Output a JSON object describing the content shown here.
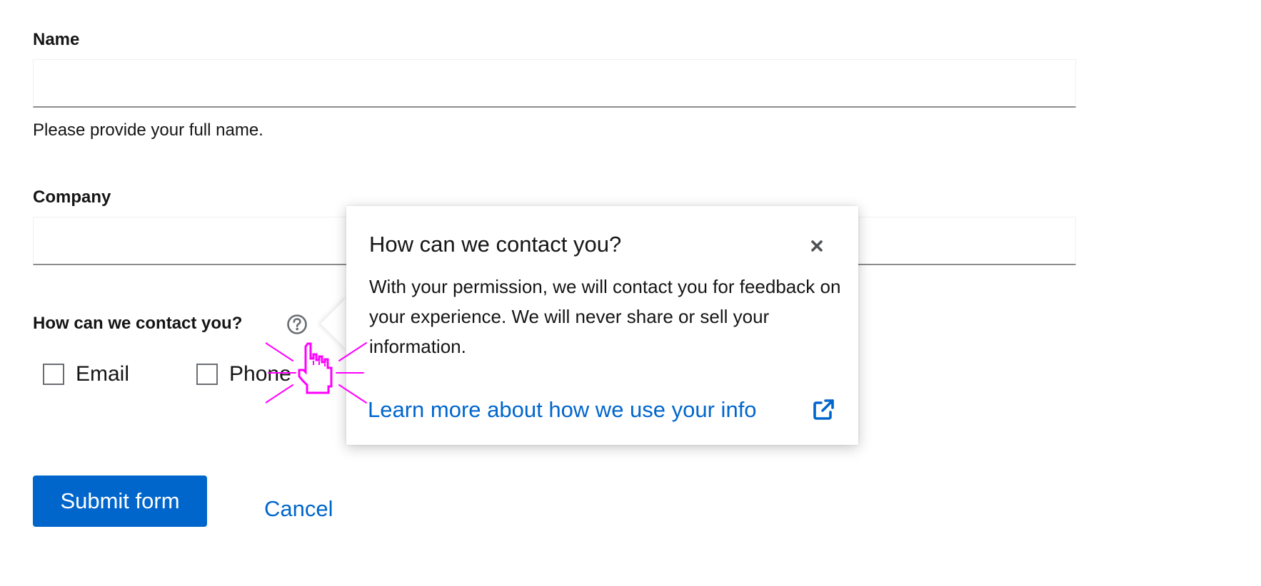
{
  "form": {
    "name": {
      "label": "Name",
      "value": "",
      "helper": "Please provide your full name."
    },
    "company": {
      "label": "Company",
      "value": ""
    },
    "contact": {
      "label": "How can we contact you?",
      "help_icon": "question-circle-icon",
      "options": [
        {
          "label": "Email",
          "checked": false
        },
        {
          "label": "Phone",
          "checked": false
        }
      ]
    },
    "actions": {
      "submit_label": "Submit form",
      "cancel_label": "Cancel"
    }
  },
  "popover": {
    "title": "How can we contact you?",
    "close_icon": "close-icon",
    "body": "With your permission, we will contact you for feedback on your experience. We will never share or sell your information.",
    "link_label": "Learn more about how we use your info",
    "link_icon": "external-link-icon"
  },
  "cursor": {
    "icon": "hand-pointer-icon",
    "color": "#ff00ff"
  },
  "colors": {
    "accent": "#0066cc",
    "text": "#151515",
    "border": "#8a8d90"
  }
}
